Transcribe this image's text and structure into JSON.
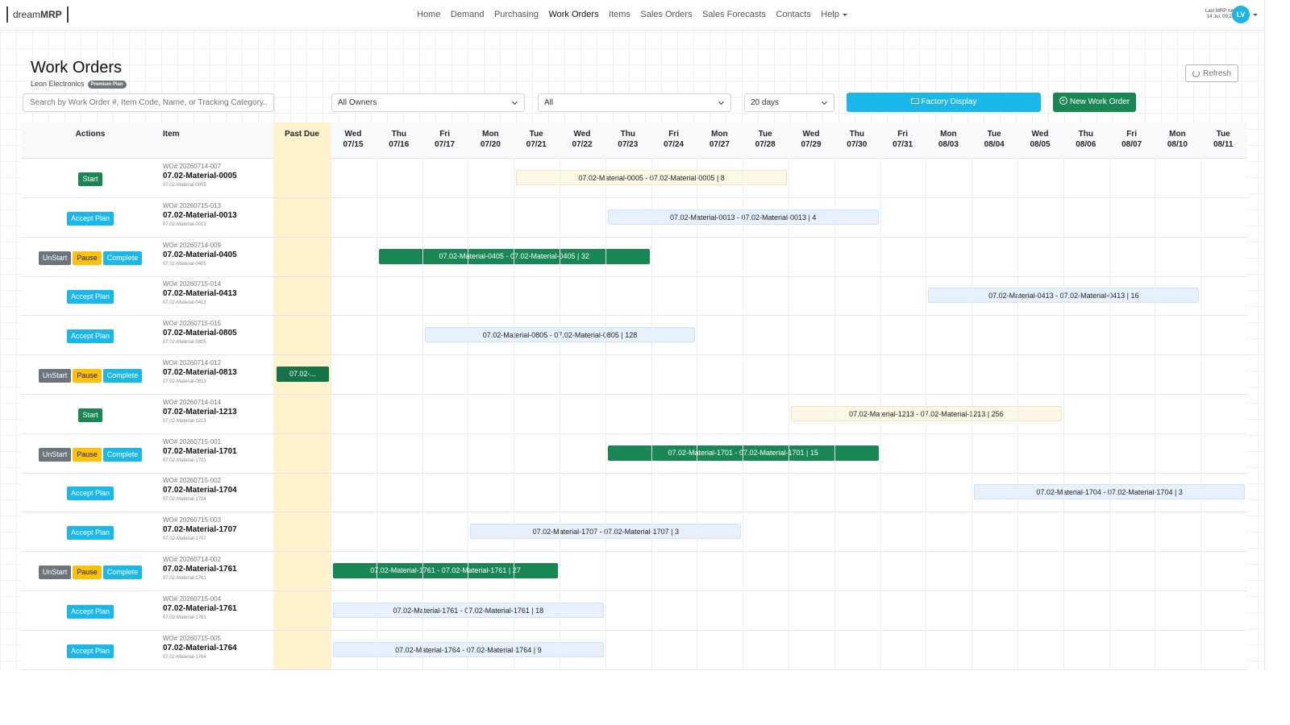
{
  "navbar": {
    "brand_prefix": "dream",
    "brand_suffix": "MRP",
    "links": [
      "Home",
      "Demand",
      "Purchasing",
      "Work Orders",
      "Items",
      "Sales Orders",
      "Sales Forecasts",
      "Contacts"
    ],
    "help": "Help",
    "mrp_label": "Last MRP run:",
    "mrp_time": "14 Jul, 09:23",
    "avatar_initials": "LV"
  },
  "header": {
    "title": "Work Orders",
    "company": "Leon Electronics",
    "plan_badge": "Premium Plan",
    "refresh_label": "Refresh"
  },
  "filters": {
    "search_placeholder": "Search by Work Order #, Item Code, Name, or Tracking Category...",
    "owner": "All Owners",
    "status": "All",
    "range": "20 days",
    "factory_label": "Factory Display",
    "new_label": "New Work Order"
  },
  "grid": {
    "actions_header": "Actions",
    "item_header": "Item",
    "past_due_header": "Past Due",
    "days": [
      {
        "dow": "Wed",
        "date": "07/15"
      },
      {
        "dow": "Thu",
        "date": "07/16"
      },
      {
        "dow": "Fri",
        "date": "07/17"
      },
      {
        "dow": "Mon",
        "date": "07/20"
      },
      {
        "dow": "Tue",
        "date": "07/21"
      },
      {
        "dow": "Wed",
        "date": "07/22"
      },
      {
        "dow": "Thu",
        "date": "07/23"
      },
      {
        "dow": "Fri",
        "date": "07/24"
      },
      {
        "dow": "Mon",
        "date": "07/27"
      },
      {
        "dow": "Tue",
        "date": "07/28"
      },
      {
        "dow": "Wed",
        "date": "07/29"
      },
      {
        "dow": "Thu",
        "date": "07/30"
      },
      {
        "dow": "Fri",
        "date": "07/31"
      },
      {
        "dow": "Mon",
        "date": "08/03"
      },
      {
        "dow": "Tue",
        "date": "08/04"
      },
      {
        "dow": "Wed",
        "date": "08/05"
      },
      {
        "dow": "Thu",
        "date": "08/06"
      },
      {
        "dow": "Fri",
        "date": "08/07"
      },
      {
        "dow": "Mon",
        "date": "08/10"
      },
      {
        "dow": "Tue",
        "date": "08/11"
      }
    ]
  },
  "action_labels": {
    "start": "Start",
    "accept": "Accept Plan",
    "unstart": "UnStart",
    "pause": "Pause",
    "complete": "Complete"
  },
  "rows": [
    {
      "wo": "WO# 20260714-007",
      "code": "07.02-Material-0005",
      "sub": "07.02-Material-0005",
      "state": "start",
      "bar": {
        "label": "07.02-Material-0005 - 07.02-Material-0005 | 8",
        "start": 4,
        "span": 6,
        "style": "pending"
      }
    },
    {
      "wo": "WO# 20260715-013",
      "code": "07.02-Material-0013",
      "sub": "07.02-Material-0013",
      "state": "accept",
      "bar": {
        "label": "07.02-Material-0013 - 07.02-Material-0013 | 4",
        "start": 6,
        "span": 6,
        "style": "planned"
      }
    },
    {
      "wo": "WO# 20260714-009",
      "code": "07.02-Material-0405",
      "sub": "07.02-Material-0405",
      "state": "inprogress",
      "bar": {
        "label": "07.02-Material-0405 - 07.02-Material-0405 | 32",
        "start": 1,
        "span": 6,
        "style": "progress"
      }
    },
    {
      "wo": "WO# 20260715-014",
      "code": "07.02-Material-0413",
      "sub": "07.02-Material-0413",
      "state": "accept",
      "bar": {
        "label": "07.02-Material-0413 - 07.02-Material-0413 | 16",
        "start": 13,
        "span": 6,
        "style": "planned"
      }
    },
    {
      "wo": "WO# 20260715-015",
      "code": "07.02-Material-0805",
      "sub": "07.02-Material-0805",
      "state": "accept",
      "bar": {
        "label": "07.02-Material-0805 - 07.02-Material-0805 | 128",
        "start": 2,
        "span": 6,
        "style": "planned"
      }
    },
    {
      "wo": "WO# 20260714-012",
      "code": "07.02-Material-0813",
      "sub": "07.02-Material-0813",
      "state": "inprogress",
      "bar": {
        "label": "07.02-...",
        "start": -1,
        "span": 1,
        "style": "past"
      }
    },
    {
      "wo": "WO# 20260714-014",
      "code": "07.02-Material-1213",
      "sub": "07.02-Material-1213",
      "state": "start",
      "bar": {
        "label": "07.02-Material-1213 - 07.02-Material-1213 | 256",
        "start": 10,
        "span": 6,
        "style": "pending"
      }
    },
    {
      "wo": "WO# 20260715-001",
      "code": "07.02-Material-1701",
      "sub": "07.02-Material-1701",
      "state": "inprogress",
      "bar": {
        "label": "07.02-Material-1701 - 07.02-Material-1701 | 15",
        "start": 6,
        "span": 6,
        "style": "progress"
      }
    },
    {
      "wo": "WO# 20260715-002",
      "code": "07.02-Material-1704",
      "sub": "07.02-Material-1704",
      "state": "accept",
      "bar": {
        "label": "07.02-Material-1704 - 07.02-Material-1704 | 3",
        "start": 14,
        "span": 6,
        "style": "planned"
      }
    },
    {
      "wo": "WO# 20260715-003",
      "code": "07.02-Material-1707",
      "sub": "07.02-Material-1707",
      "state": "accept",
      "bar": {
        "label": "07.02-Material-1707 - 07.02-Material-1707 | 3",
        "start": 3,
        "span": 6,
        "style": "planned"
      }
    },
    {
      "wo": "WO# 20260714-002",
      "code": "07.02-Material-1761",
      "sub": "07.02-Material-1761",
      "state": "inprogress",
      "bar": {
        "label": "07.02-Material-1761 - 07.02-Material-1761 | 27",
        "start": 0,
        "span": 5,
        "style": "progress"
      }
    },
    {
      "wo": "WO# 20260715-004",
      "code": "07.02-Material-1761",
      "sub": "07.02-Material-1761",
      "state": "accept",
      "bar": {
        "label": "07.02-Material-1761 - 07.02-Material-1761 | 18",
        "start": 0,
        "span": 6,
        "style": "planned"
      }
    },
    {
      "wo": "WO# 20260715-005",
      "code": "07.02-Material-1764",
      "sub": "07.02-Material-1764",
      "state": "accept",
      "bar": {
        "label": "07.02-Material-1764 - 07.02-Material-1764 | 9",
        "start": 0,
        "span": 6,
        "style": "planned"
      }
    }
  ],
  "colors": {
    "accent_blue": "#1ab7ea",
    "success_green": "#198754",
    "warning_yellow": "#ffc107",
    "secondary_gray": "#6c757d",
    "past_due_bg": "#fff3cd"
  },
  "icons": {
    "refresh": "refresh-icon",
    "factory": "monitor-icon",
    "new": "plus-circle-icon",
    "dropdown": "chevron-down-icon"
  }
}
